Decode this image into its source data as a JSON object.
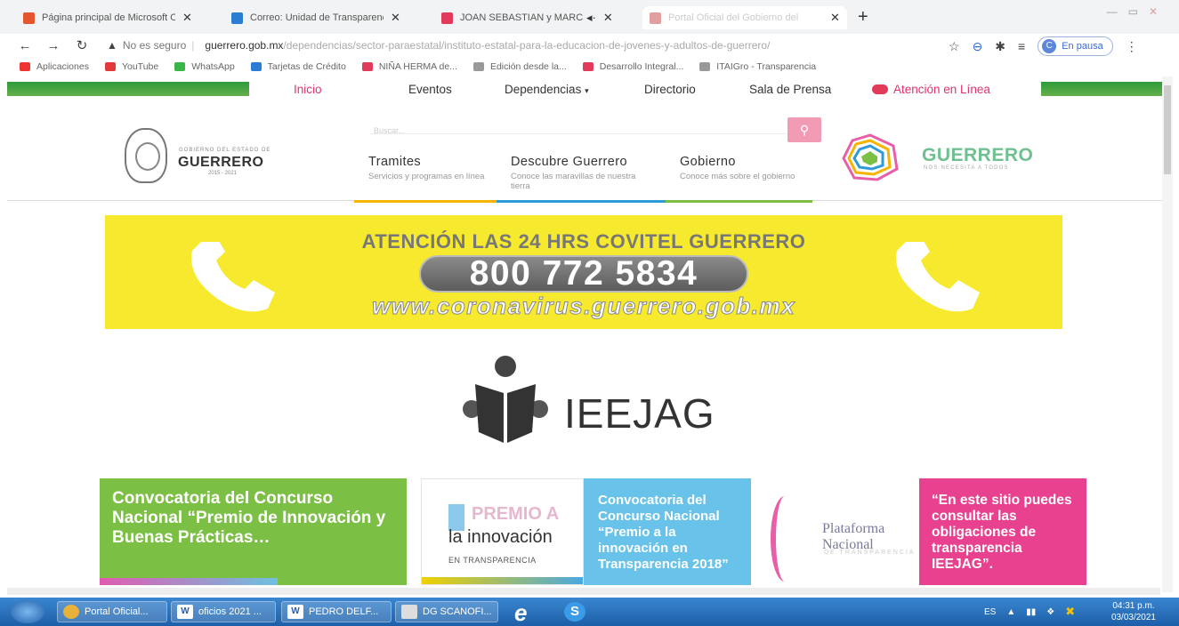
{
  "browser": {
    "tabs": [
      {
        "title": "Página principal de Microsoft O",
        "favicon_color": "#e4572e",
        "active": false
      },
      {
        "title": "Correo: Unidad de Transparenc",
        "favicon_color": "#2b7cd3",
        "active": false
      },
      {
        "title": "JOAN SEBASTIAN y MARC",
        "favicon_color": "#e23a5a",
        "active": true
      },
      {
        "title": "Portal Oficial del Gobierno del",
        "favicon_color": "#e0a0a0",
        "active": false
      }
    ],
    "new_tab": "+",
    "close": "✕"
  },
  "address": {
    "security_label": "No es seguro",
    "domain": "guerrero.gob.mx",
    "path": "/dependencias/sector-paraestatal/instituto-estatal-para-la-educacion-de-jovenes-y-adultos-de-guerrero/",
    "profile_initial": "C",
    "profile_status": "En pausa"
  },
  "bookmarks": [
    {
      "label": "Aplicaciones",
      "color": "#e33"
    },
    {
      "label": "YouTube",
      "color": "#e23a3a"
    },
    {
      "label": "WhatsApp",
      "color": "#3bb54a"
    },
    {
      "label": "Tarjetas de Crédito",
      "color": "#2b7cd3"
    },
    {
      "label": "NIÑA HERMA de...",
      "color": "#e23a5a"
    },
    {
      "label": "Edición desde la...",
      "color": "#999"
    },
    {
      "label": "Desarrollo Integral...",
      "color": "#e23a5a"
    },
    {
      "label": "ITAIGro - Transparencia",
      "color": "#999"
    }
  ],
  "site_nav": {
    "items": [
      "Inicio",
      "Eventos",
      "Dependencias",
      "Directorio",
      "Sala de Prensa",
      "Atención en Línea"
    ]
  },
  "header": {
    "gob_small": "GOBIERNO DEL ESTADO DE",
    "gob_name": "GUERRERO",
    "gob_years": "2015 - 2021",
    "search_placeholder": "Buscar...",
    "menu": [
      {
        "title": "Tramites",
        "sub": "Servicios y programas en línea",
        "color": "#f5b400"
      },
      {
        "title": "Descubre Guerrero",
        "sub": "Conoce las maravillas de nuestra tierra",
        "color": "#2e9ad8"
      },
      {
        "title": "Gobierno",
        "sub": "Conoce más sobre el gobierno",
        "color": "#7cbf45"
      }
    ],
    "state_name": "GUERRERO",
    "state_tag": "NOS NECESITA A TODOS"
  },
  "banner": {
    "headline": "ATENCIÓN LAS 24 HRS COVITEL GUERRERO",
    "phone": "800 772 5834",
    "url": "www.coronavirus.guerrero.gob.mx"
  },
  "ieejag": {
    "name": "IEEJAG"
  },
  "cards": {
    "c1": "Convocatoria del Concurso Nacional “Premio de Innovación y Buenas Prácticas…",
    "c2_premio": "PREMIO A",
    "c2_innov": "la innovación",
    "c2_en": "EN TRANSPARENCIA",
    "c3": "Convocatoria del Concurso Nacional “Premio a la innovación en Transparencia 2018”",
    "c4": "Plataforma Nacional",
    "c4_sub": "DE TRANSPARENCIA",
    "c5": "“En este sitio puedes consultar las obligaciones de transparencia IEEJAG”."
  },
  "taskbar": {
    "items": [
      {
        "label": "Portal Oficial...",
        "icon": "chrome-icon",
        "color": "#e8b23a"
      },
      {
        "label": "oficios 2021 ...",
        "icon": "word-icon",
        "color": "#fff"
      },
      {
        "label": "PEDRO DELF...",
        "icon": "word-icon",
        "color": "#fff"
      },
      {
        "label": "DG SCANOFI...",
        "icon": "scanner-icon",
        "color": "#ddd"
      }
    ],
    "lang": "ES",
    "time": "04:31 p.m.",
    "date": "03/03/2021"
  }
}
